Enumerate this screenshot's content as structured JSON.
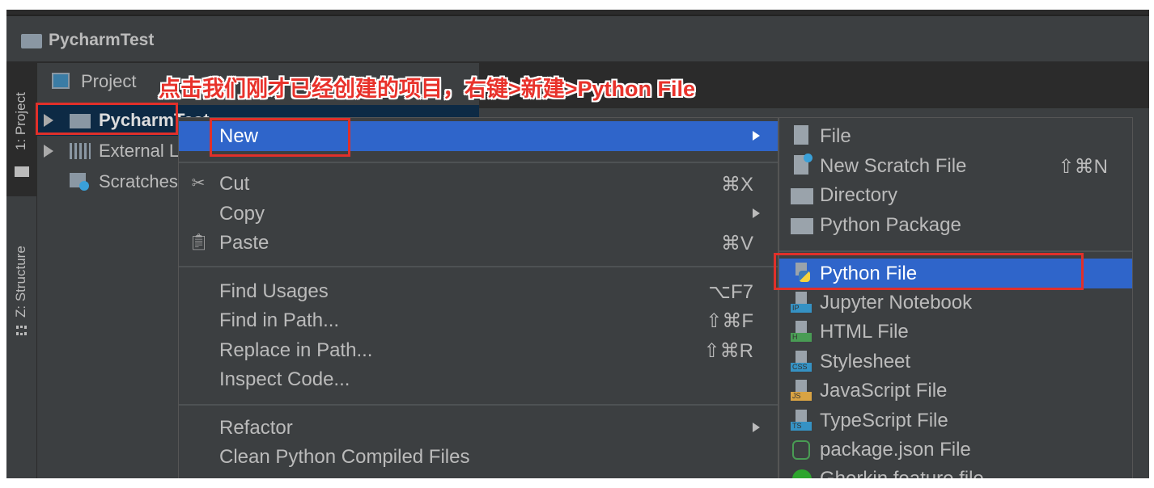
{
  "window": {
    "title": "PycharmTest"
  },
  "tool_strip": {
    "project_tab": "1: Project",
    "structure_tab": "Z: Structure"
  },
  "project_panel": {
    "header": "Project",
    "tree": [
      {
        "label": "PycharmTest",
        "selected": true
      },
      {
        "label": "External Libraries"
      },
      {
        "label": "Scratches and Consoles"
      }
    ]
  },
  "annotation": "点击我们刚才已经创建的项目，右键>新建>Python File",
  "context_menu": {
    "items": [
      {
        "label": "New",
        "shortcut": "",
        "submenu": true,
        "highlighted": true,
        "icon": ""
      },
      {
        "label": "Cut",
        "shortcut": "⌘X",
        "icon": "scissors-icon"
      },
      {
        "label": "Copy",
        "shortcut": "",
        "submenu": true,
        "icon": ""
      },
      {
        "label": "Paste",
        "shortcut": "⌘V",
        "icon": "clipboard-icon"
      },
      {
        "label": "Find Usages",
        "shortcut": "⌥F7"
      },
      {
        "label": "Find in Path...",
        "shortcut": "⇧⌘F"
      },
      {
        "label": "Replace in Path...",
        "shortcut": "⇧⌘R"
      },
      {
        "label": "Inspect Code...",
        "shortcut": ""
      },
      {
        "label": "Refactor",
        "shortcut": "",
        "submenu": true
      },
      {
        "label": "Clean Python Compiled Files",
        "shortcut": ""
      }
    ]
  },
  "new_submenu": {
    "items": [
      {
        "label": "File",
        "shortcut": "",
        "icon": "file-icon"
      },
      {
        "label": "New Scratch File",
        "shortcut": "⇧⌘N",
        "icon": "scratch-file-icon"
      },
      {
        "label": "Directory",
        "shortcut": "",
        "icon": "folder-icon"
      },
      {
        "label": "Python Package",
        "shortcut": "",
        "icon": "package-icon"
      },
      {
        "label": "Python File",
        "shortcut": "",
        "icon": "python-file-icon",
        "highlighted": true
      },
      {
        "label": "Jupyter Notebook",
        "icon": "jupyter-icon",
        "badge": "IP",
        "color": "#3592c4"
      },
      {
        "label": "HTML File",
        "icon": "html-file-icon",
        "badge": "H",
        "color": "#499c54"
      },
      {
        "label": "Stylesheet",
        "icon": "css-file-icon",
        "badge": "CSS",
        "color": "#3592c4"
      },
      {
        "label": "JavaScript File",
        "icon": "js-file-icon",
        "badge": "JS",
        "color": "#d9a343"
      },
      {
        "label": "TypeScript File",
        "icon": "ts-file-icon",
        "badge": "TS",
        "color": "#3592c4"
      },
      {
        "label": "package.json File",
        "icon": "nodejs-icon"
      },
      {
        "label": "Gherkin feature file",
        "icon": "gherkin-icon"
      }
    ]
  },
  "colors": {
    "highlight": "#2f65ca",
    "annotation": "#e8322b",
    "menu_bg": "#3c3f41"
  }
}
